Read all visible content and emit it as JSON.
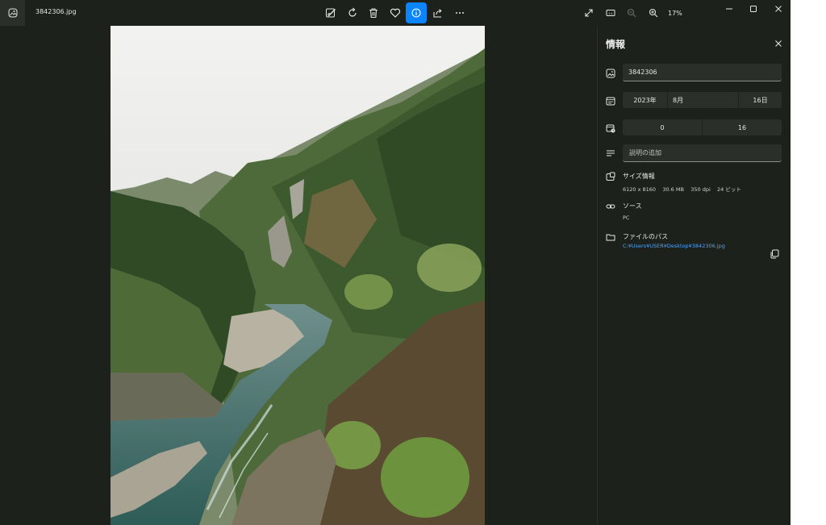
{
  "titlebar": {
    "filename": "3842306.jpg",
    "zoom": "17%",
    "toolbar_icons": [
      "edit-image-icon",
      "rotate-icon",
      "delete-icon",
      "favorite-icon",
      "info-icon",
      "share-icon",
      "more-icon"
    ],
    "right_icons": [
      "fullscreen-icon",
      "actual-size-icon",
      "zoom-out-icon",
      "zoom-in-icon"
    ]
  },
  "panel": {
    "title": "情報",
    "filename_value": "3842306",
    "date": {
      "year": "2023年",
      "month": "8月",
      "day": "16日"
    },
    "time": {
      "hour": "0",
      "minute": "16"
    },
    "description_placeholder": "説明の追加",
    "size_label": "サイズ情報",
    "dimensions": "6120 x 8160",
    "filesize": "30.6 MB",
    "dpi": "350 dpi",
    "bitdepth": "24 ビット",
    "source_label": "ソース",
    "source_value": "PC",
    "path_label": "ファイルのパス",
    "path_value": "C:¥Users¥USER¥Desktop¥3842306.jpg"
  },
  "colors": {
    "accent": "#0a84ff",
    "background": "#1c211c",
    "field": "#2a2f2a",
    "link": "#4aa3ff"
  }
}
